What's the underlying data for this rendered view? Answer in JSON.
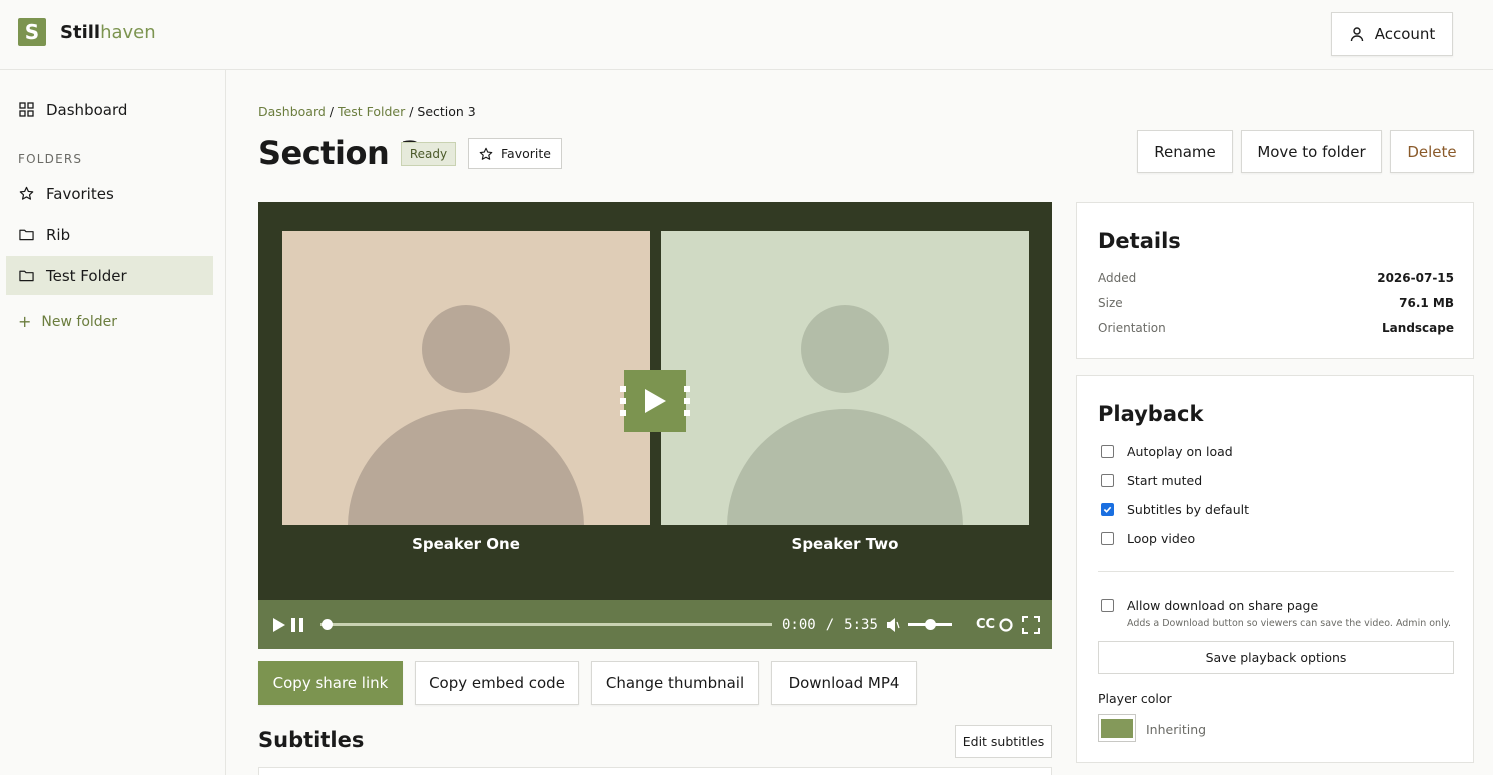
{
  "brand": {
    "mark": "S",
    "name_a": "Still",
    "name_b": "haven",
    "accent": "#7c9450"
  },
  "header": {
    "account_label": "Account",
    "account_icon": "user-icon"
  },
  "sidebar": {
    "dashboard": "Dashboard",
    "section_label": "FOLDERS",
    "items": [
      {
        "label": "Favorites",
        "icon": "star-icon"
      },
      {
        "label": "Rib",
        "icon": "folder-icon"
      },
      {
        "label": "Test Folder",
        "icon": "folder-icon",
        "active": true
      }
    ],
    "new_folder": "New folder"
  },
  "breadcrumb": {
    "root": "Dashboard",
    "folder": "Test Folder",
    "current": "Section 3",
    "sep": " / "
  },
  "page": {
    "title": "Section 3",
    "status": "Ready",
    "favorite_label": "Favorite",
    "actions": {
      "rename": "Rename",
      "move": "Move to folder",
      "delete": "Delete"
    }
  },
  "player": {
    "speakers": [
      "Speaker One",
      "Speaker Two"
    ],
    "time_current": "0:00",
    "time_sep": "/",
    "time_total": "5:35",
    "progress": 0.0,
    "volume": 0.5,
    "cc_label": "CC"
  },
  "video_actions": {
    "copy_share": "Copy share link",
    "copy_embed": "Copy embed code",
    "change_thumb": "Change thumbnail",
    "download": "Download MP4"
  },
  "subtitles": {
    "title": "Subtitles",
    "edit_label": "Edit subtitles"
  },
  "details": {
    "title": "Details",
    "rows": [
      {
        "key": "Added",
        "value": "2026-07-15"
      },
      {
        "key": "Size",
        "value": "76.1 MB"
      },
      {
        "key": "Orientation",
        "value": "Landscape"
      }
    ]
  },
  "playback": {
    "title": "Playback",
    "options": [
      {
        "label": "Autoplay on load",
        "checked": false
      },
      {
        "label": "Start muted",
        "checked": false
      },
      {
        "label": "Subtitles by default",
        "checked": true
      },
      {
        "label": "Loop video",
        "checked": false
      }
    ],
    "download_option": {
      "label": "Allow download on share page",
      "checked": false,
      "hint": "Adds a Download button so viewers can save the video. Admin only."
    },
    "save_label": "Save playback options",
    "player_color_label": "Player color",
    "player_color_value": "#84995a",
    "player_color_state": "Inheriting"
  }
}
